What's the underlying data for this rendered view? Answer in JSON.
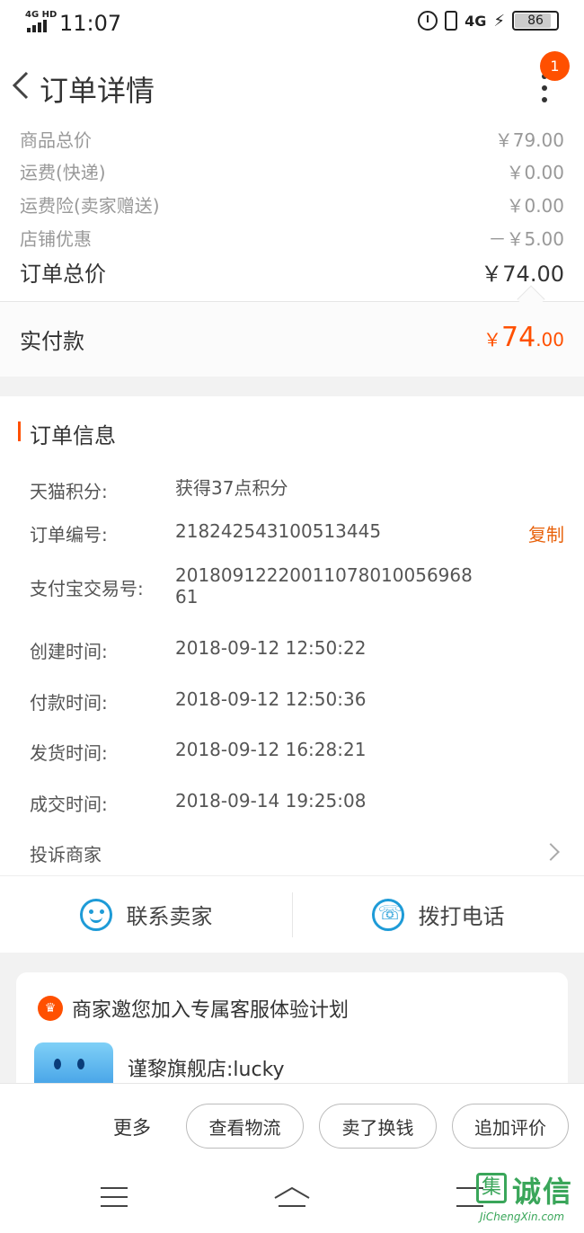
{
  "status_bar": {
    "network": "4G HD",
    "time": "11:07",
    "signal_type": "4G",
    "battery": "86"
  },
  "nav": {
    "title": "订单详情",
    "badge_count": "1"
  },
  "price": {
    "rows": [
      {
        "label": "商品总价",
        "value": "￥79.00"
      },
      {
        "label": "运费(快递)",
        "value": "￥0.00"
      },
      {
        "label": "运费险(卖家赠送)",
        "value": "￥0.00"
      },
      {
        "label": "店铺优惠",
        "value": "－￥5.00"
      }
    ],
    "total_label": "订单总价",
    "total_value": "￥74.00",
    "paid_label": "实付款",
    "paid_currency": "￥",
    "paid_int": "74",
    "paid_dec": ".00"
  },
  "order_info": {
    "title": "订单信息",
    "rows": [
      {
        "label": "天猫积分:",
        "value": "获得37点积分"
      },
      {
        "label": "订单编号:",
        "value": "218242543100513445",
        "action": "复制"
      },
      {
        "label": "支付宝交易号:",
        "value": "20180912220011078010056968 61"
      },
      {
        "label": "创建时间:",
        "value": "2018-09-12 12:50:22"
      },
      {
        "label": "付款时间:",
        "value": "2018-09-12 12:50:36"
      },
      {
        "label": "发货时间:",
        "value": "2018-09-12 16:28:21"
      },
      {
        "label": "成交时间:",
        "value": "2018-09-14 19:25:08"
      }
    ],
    "complain": "投诉商家",
    "contact_seller": "联系卖家",
    "call_phone": "拨打电话"
  },
  "service": {
    "title": "商家邀您加入专属客服体验计划",
    "shop": "谨黎旗舰店:lucky"
  },
  "bottom": {
    "more": "更多",
    "buttons": [
      "查看物流",
      "卖了换钱",
      "追加评价"
    ]
  },
  "watermark": {
    "box": "集",
    "text": "诚信",
    "sub": "JiChengXin.com"
  },
  "colors": {
    "accent": "#ff5000",
    "link_orange": "#e8620c",
    "icon_blue": "#1e9bd7"
  }
}
